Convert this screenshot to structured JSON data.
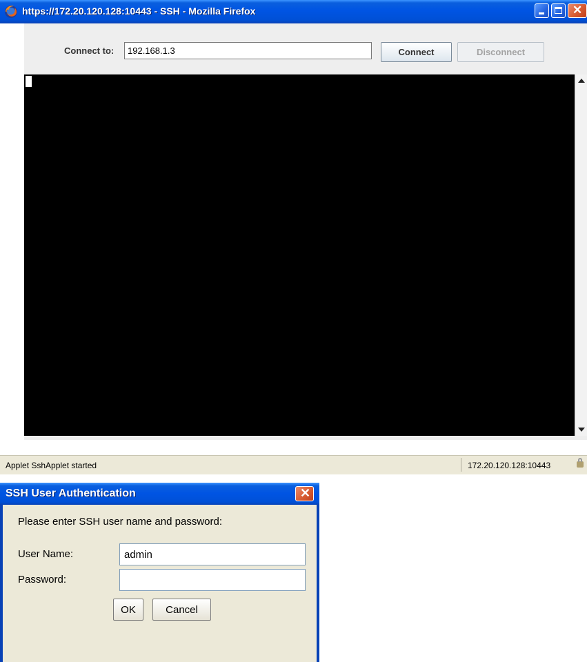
{
  "browser_window": {
    "title": "https://172.20.120.128:10443 - SSH - Mozilla Firefox",
    "icon": "firefox-icon"
  },
  "applet": {
    "connect_label": "Connect to:",
    "connect_value": "192.168.1.3",
    "connect_button": "Connect",
    "disconnect_button": "Disconnect",
    "disconnect_enabled": false
  },
  "status_bar": {
    "left_text": "Applet SshApplet started",
    "right_text": "172.20.120.128:10443",
    "icon": "lock-icon"
  },
  "auth_dialog": {
    "title": "SSH User Authentication",
    "prompt": "Please enter SSH user name and password:",
    "user_label": "User Name:",
    "user_value": "admin",
    "password_label": "Password:",
    "password_value": "",
    "ok_button": "OK",
    "cancel_button": "Cancel"
  },
  "colors": {
    "titlebar_blue": "#0054e3",
    "dialog_bg": "#ece9d8",
    "terminal_bg": "#000000",
    "applet_bg": "#eeeeee"
  }
}
